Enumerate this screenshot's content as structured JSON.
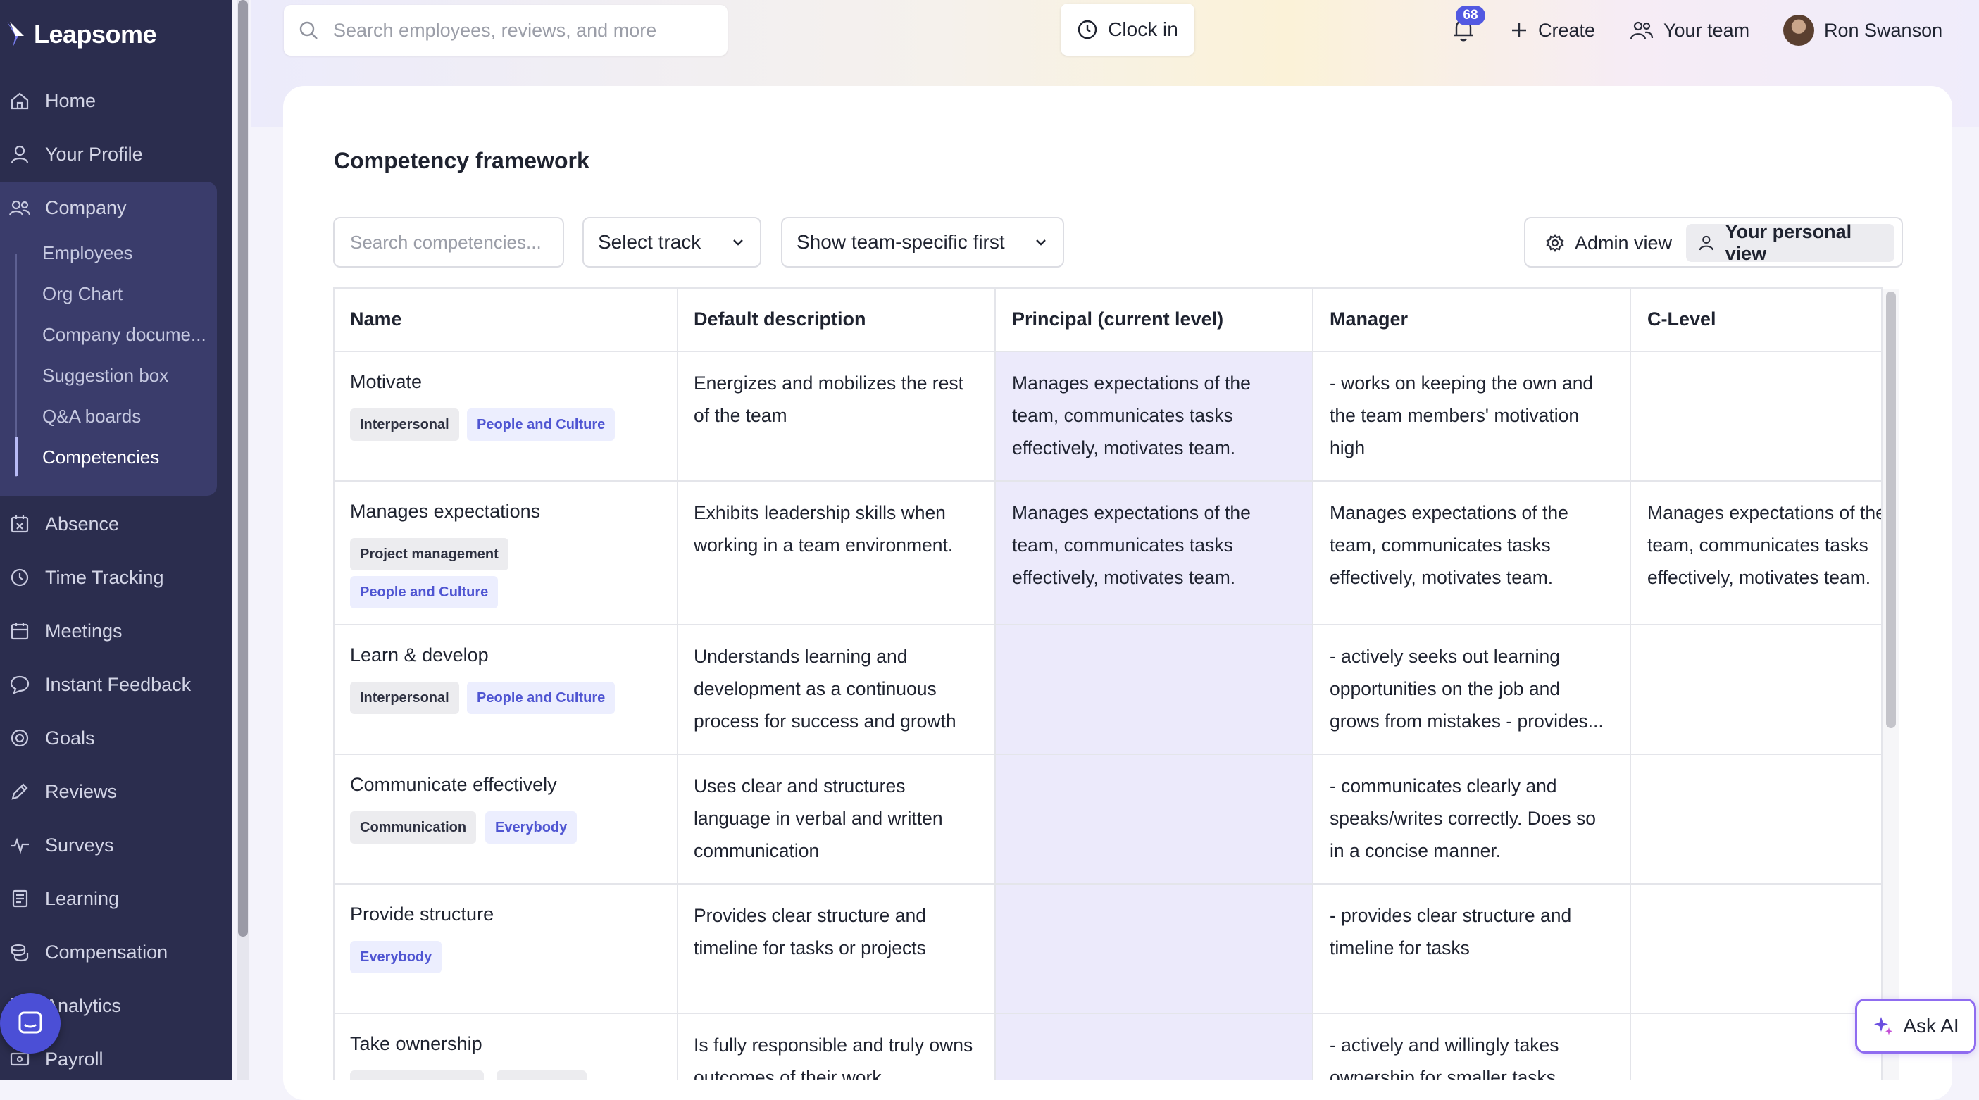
{
  "app": {
    "name": "Leapsome"
  },
  "sidebar": {
    "items": [
      {
        "label": "Home",
        "icon": "home-icon"
      },
      {
        "label": "Your Profile",
        "icon": "user-icon"
      },
      {
        "label": "Company",
        "icon": "users-icon"
      },
      {
        "label": "Absence",
        "icon": "calendar-x-icon"
      },
      {
        "label": "Time Tracking",
        "icon": "clock-icon"
      },
      {
        "label": "Meetings",
        "icon": "calendar-icon"
      },
      {
        "label": "Instant Feedback",
        "icon": "chat-icon"
      },
      {
        "label": "Goals",
        "icon": "target-icon"
      },
      {
        "label": "Reviews",
        "icon": "pen-icon"
      },
      {
        "label": "Surveys",
        "icon": "pulse-icon"
      },
      {
        "label": "Learning",
        "icon": "book-icon"
      },
      {
        "label": "Compensation",
        "icon": "coins-icon"
      },
      {
        "label": "Analytics",
        "icon": "chart-icon"
      },
      {
        "label": "Payroll",
        "icon": "payroll-icon"
      }
    ],
    "company_sub": [
      "Employees",
      "Org Chart",
      "Company docume...",
      "Suggestion box",
      "Q&A boards",
      "Competencies"
    ],
    "active_sub": "Competencies"
  },
  "topbar": {
    "search_placeholder": "Search employees, reviews, and more",
    "clock_in": "Clock in",
    "notifications": "68",
    "create": "Create",
    "your_team": "Your team",
    "user_name": "Ron Swanson"
  },
  "page": {
    "title": "Competency framework",
    "search_placeholder": "Search competencies...",
    "track_select": "Select track",
    "sort_select": "Show team-specific first",
    "admin_view": "Admin view",
    "personal_view": "Your personal view"
  },
  "table": {
    "headers": [
      "Name",
      "Default description",
      "Principal (current level)",
      "Manager",
      "C-Level"
    ],
    "rows": [
      {
        "name": "Motivate",
        "tags": [
          {
            "text": "Interpersonal",
            "kind": "cat"
          },
          {
            "text": "People and Culture",
            "kind": "grp"
          }
        ],
        "description": [
          "Energizes and mobilizes the rest",
          "of the team"
        ],
        "principal": [
          "Manages expectations of the",
          "team, communicates tasks",
          "effectively, motivates team."
        ],
        "manager": [
          "- works on keeping the own and",
          "the team members' motivation",
          "high"
        ],
        "clevel": []
      },
      {
        "name": "Manages expectations",
        "tags": [
          {
            "text": "Project management",
            "kind": "cat"
          },
          {
            "text": "People and Culture",
            "kind": "grp"
          }
        ],
        "description": [
          "Exhibits leadership skills when",
          "working in a team environment."
        ],
        "principal": [
          "Manages expectations of the",
          "team, communicates tasks",
          "effectively, motivates team."
        ],
        "manager": [
          "Manages expectations of the",
          "team, communicates tasks",
          "effectively, motivates team."
        ],
        "clevel": [
          "Manages expectations of the",
          "team, communicates tasks",
          "effectively, motivates team."
        ]
      },
      {
        "name": "Learn & develop",
        "tags": [
          {
            "text": "Interpersonal",
            "kind": "cat"
          },
          {
            "text": "People and Culture",
            "kind": "grp"
          }
        ],
        "description": [
          "Understands learning and",
          "development as a continuous",
          "process for success and growth"
        ],
        "principal": [],
        "manager": [
          "- actively seeks out learning",
          "opportunities on the job and",
          "grows from mistakes - provides..."
        ],
        "clevel": []
      },
      {
        "name": "Communicate effectively",
        "tags": [
          {
            "text": "Communication",
            "kind": "cat"
          },
          {
            "text": "Everybody",
            "kind": "grp"
          }
        ],
        "description": [
          "Uses clear and structures",
          "language in verbal and written",
          "communication"
        ],
        "principal": [],
        "manager": [
          "- communicates clearly and",
          "speaks/writes correctly. Does so",
          "in a concise manner."
        ],
        "clevel": []
      },
      {
        "name": "Provide structure",
        "tags": [
          {
            "text": "Everybody",
            "kind": "grp"
          }
        ],
        "description": [
          "Provides clear structure and",
          "timeline for tasks or projects"
        ],
        "principal": [],
        "manager": [
          "- provides clear structure and",
          "timeline for tasks"
        ],
        "clevel": []
      },
      {
        "name": "Take ownership",
        "tags": [],
        "description": [
          "Is fully responsible and truly owns",
          "outcomes of their work"
        ],
        "principal": [],
        "manager": [
          "- actively and willingly takes",
          "ownership for smaller tasks"
        ],
        "clevel": []
      }
    ]
  },
  "ask_ai": "Ask AI",
  "colors": {
    "sidebar": "#2b2d4e",
    "accent": "#5259e2",
    "current_level_col": "#eceafb"
  }
}
